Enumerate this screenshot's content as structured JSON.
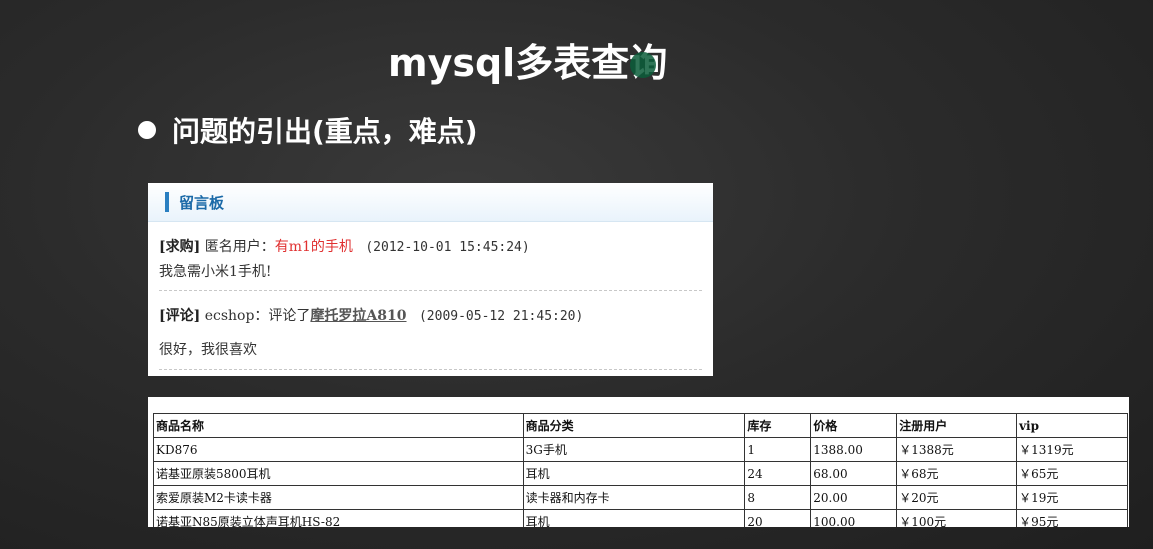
{
  "slide": {
    "title": "mysql多表查询",
    "bullet": "问题的引出(重点，难点)"
  },
  "board": {
    "header": "留言板",
    "messages": [
      {
        "type": "[求购]",
        "user": "匿名用户：",
        "subject": "有m1的手机",
        "time": "(2012-10-01 15:45:24)",
        "body": "我急需小米1手机!"
      },
      {
        "type": "[评论]",
        "user": "ecshop：评论了",
        "subject": "摩托罗拉A810",
        "time": "(2009-05-12 21:45:20)",
        "body": "很好，我很喜欢"
      }
    ]
  },
  "products": {
    "headers": [
      "商品名称",
      "商品分类",
      "库存",
      "价格",
      "注册用户",
      "vip"
    ],
    "rows": [
      [
        "KD876",
        "3G手机",
        "1",
        "1388.00",
        "￥1388元",
        "￥1319元"
      ],
      [
        "诺基亚原装5800耳机",
        "耳机",
        "24",
        "68.00",
        "￥68元",
        "￥65元"
      ],
      [
        "索爱原装M2卡读卡器",
        "读卡器和内存卡",
        "8",
        "20.00",
        "￥20元",
        "￥19元"
      ],
      [
        "诺基亚N85原装立体声耳机HS-82",
        "耳机",
        "20",
        "100.00",
        "￥100元",
        "￥95元"
      ]
    ]
  },
  "colors": {
    "background": "#2b2b2b",
    "board_accent": "#2a7fc1",
    "highlight_red": "#e03030"
  }
}
